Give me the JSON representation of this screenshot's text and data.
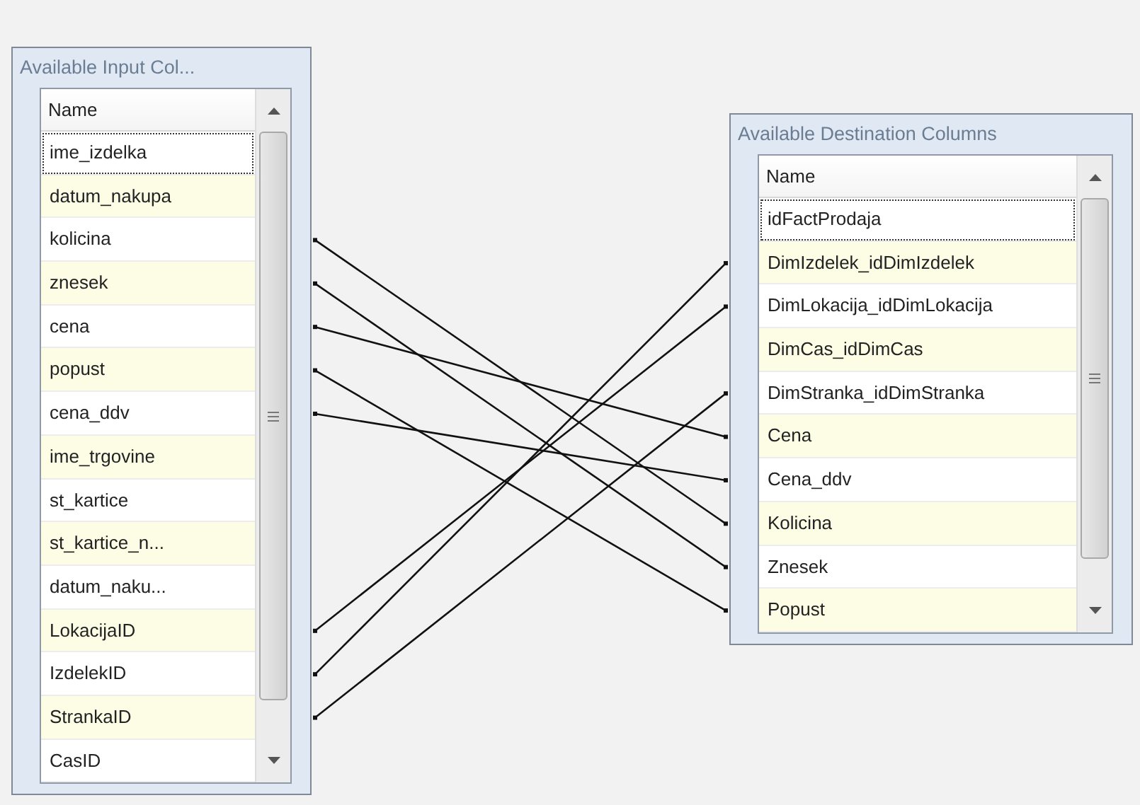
{
  "input_panel": {
    "title": "Available Input Col...",
    "header": "Name",
    "columns": [
      {
        "name": "ime_izdelka",
        "focused": true
      },
      {
        "name": "datum_nakupa",
        "focused": false
      },
      {
        "name": "kolicina",
        "focused": false
      },
      {
        "name": "znesek",
        "focused": false
      },
      {
        "name": "cena",
        "focused": false
      },
      {
        "name": "popust",
        "focused": false
      },
      {
        "name": "cena_ddv",
        "focused": false
      },
      {
        "name": "ime_trgovine",
        "focused": false
      },
      {
        "name": "st_kartice",
        "focused": false
      },
      {
        "name": "st_kartice_n...",
        "focused": false
      },
      {
        "name": "datum_naku...",
        "focused": false
      },
      {
        "name": "LokacijaID",
        "focused": false
      },
      {
        "name": "IzdelekID",
        "focused": false
      },
      {
        "name": "StrankaID",
        "focused": false
      },
      {
        "name": "CasID",
        "focused": false
      }
    ]
  },
  "destination_panel": {
    "title": "Available Destination Columns",
    "header": "Name",
    "columns": [
      {
        "name": "idFactProdaja",
        "focused": true
      },
      {
        "name": "DimIzdelek_idDimIzdelek",
        "focused": false
      },
      {
        "name": "DimLokacija_idDimLokacija",
        "focused": false
      },
      {
        "name": "DimCas_idDimCas",
        "focused": false
      },
      {
        "name": "DimStranka_idDimStranka",
        "focused": false
      },
      {
        "name": "Cena",
        "focused": false
      },
      {
        "name": "Cena_ddv",
        "focused": false
      },
      {
        "name": "Kolicina",
        "focused": false
      },
      {
        "name": "Znesek",
        "focused": false
      },
      {
        "name": "Popust",
        "focused": false
      }
    ]
  }
}
